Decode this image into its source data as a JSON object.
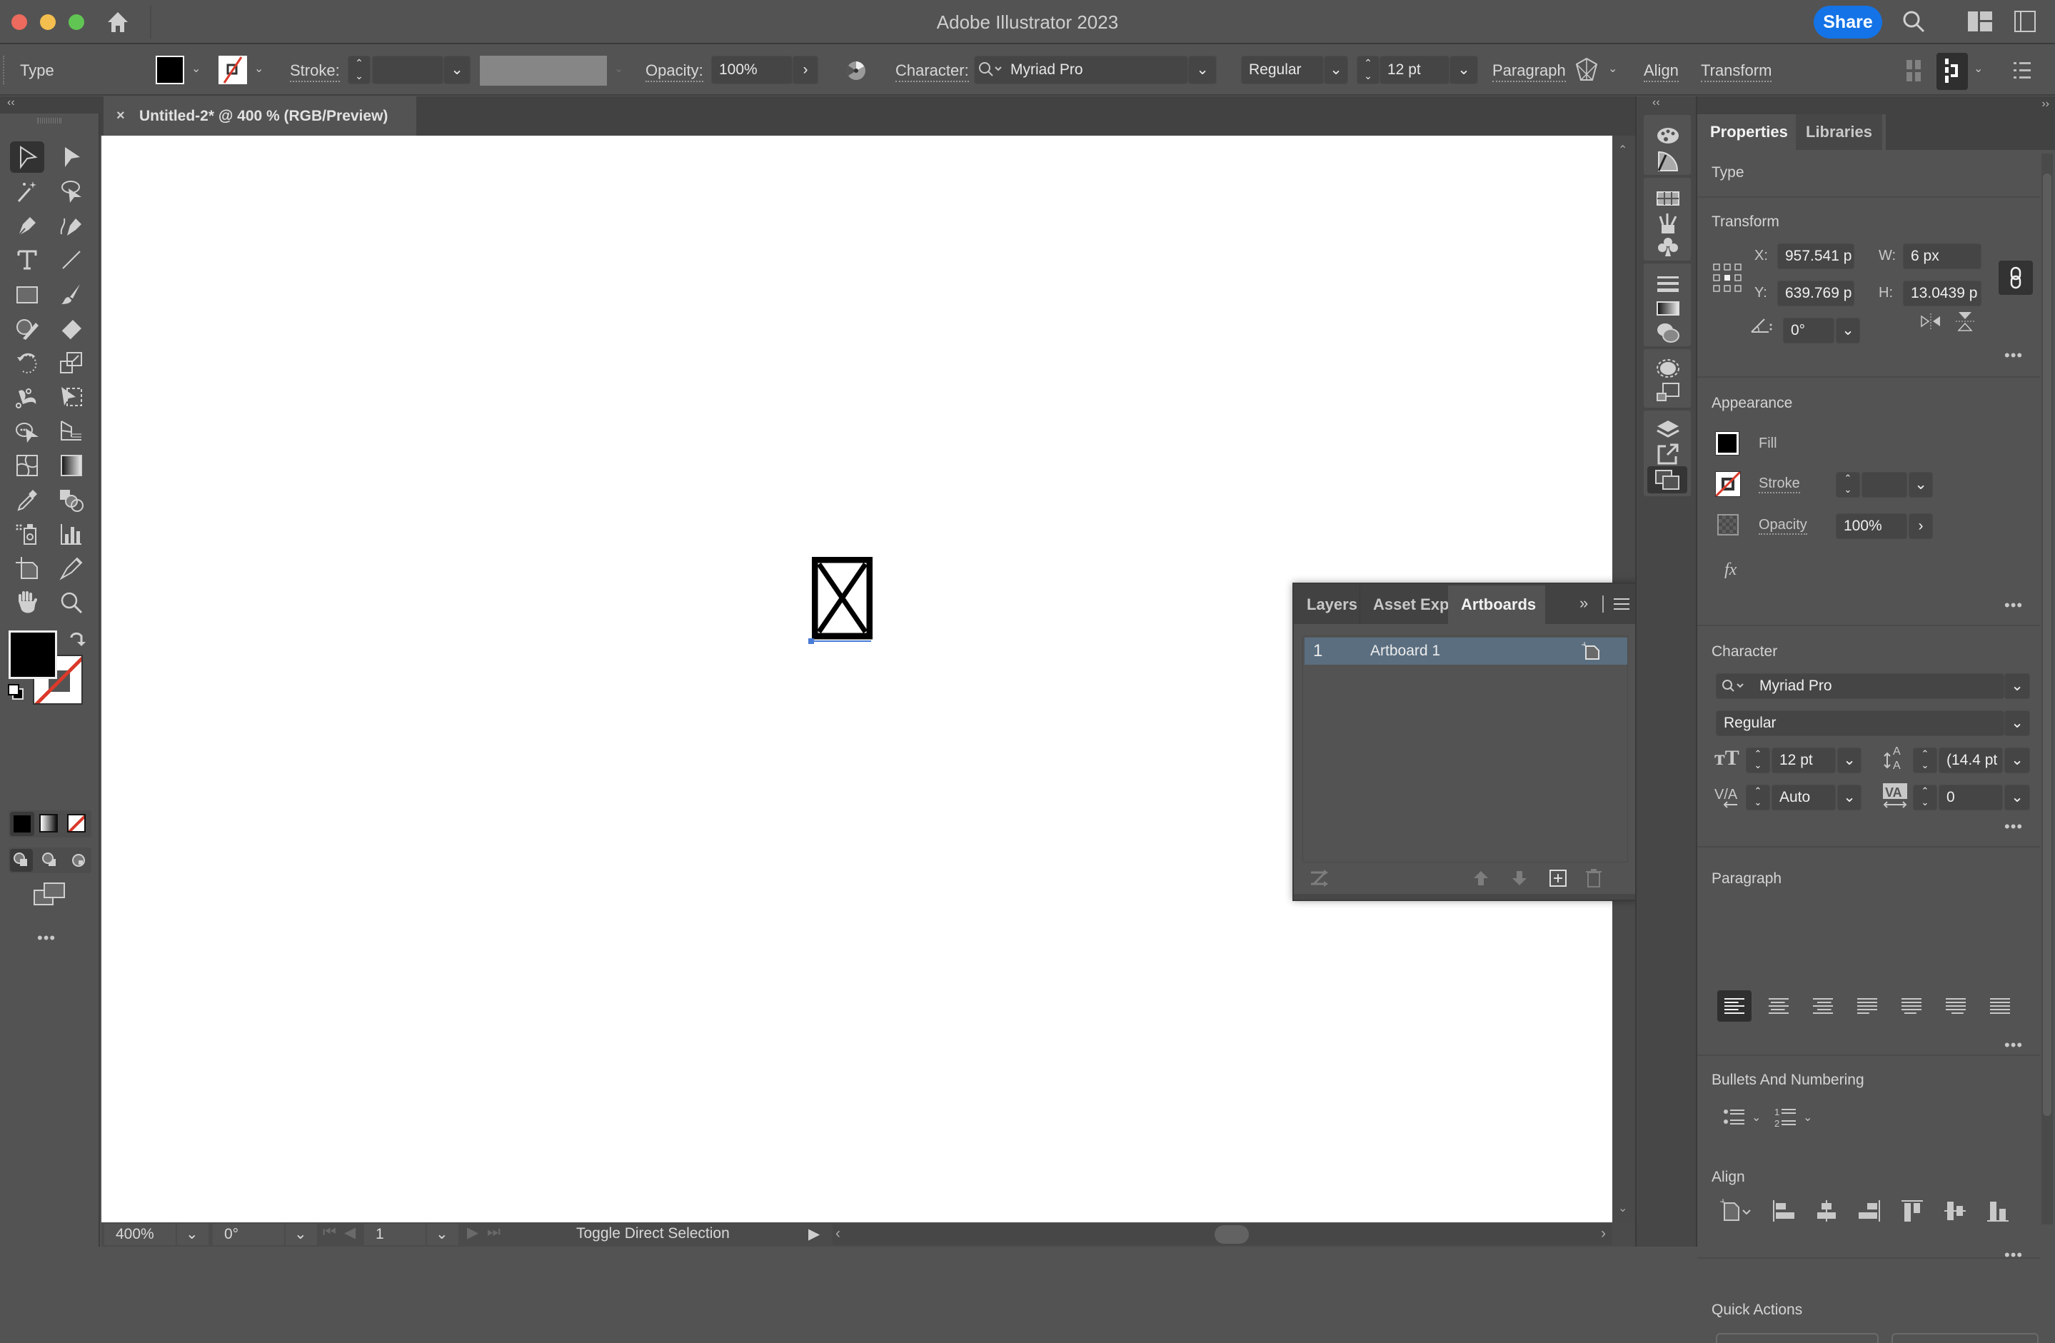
{
  "window": {
    "app_title": "Adobe Illustrator 2023",
    "share_label": "Share",
    "icons": [
      "home-icon",
      "search-icon",
      "workspace-switcher-icon",
      "arrange-documents-icon"
    ]
  },
  "control_bar": {
    "selection_type": "Type",
    "stroke_label": "Stroke:",
    "stroke_value": "",
    "opacity_label": "Opacity:",
    "opacity_value": "100%",
    "character_label": "Character:",
    "font_family": "Myriad Pro",
    "font_style": "Regular",
    "font_size": "12 pt",
    "paragraph_label": "Paragraph",
    "align_label": "Align",
    "transform_label": "Transform",
    "colors": {
      "fill": "#000000",
      "stroke": "none"
    }
  },
  "document_tab": {
    "close_glyph": "×",
    "title": "Untitled-2* @ 400 % (RGB/Preview)"
  },
  "toolbar": {
    "tools": [
      "selection-tool",
      "direct-selection-tool",
      "magic-wand-tool",
      "lasso-tool",
      "pen-tool",
      "curvature-tool",
      "type-tool",
      "line-segment-tool",
      "rectangle-tool",
      "paintbrush-tool",
      "shaper-tool",
      "eraser-tool",
      "rotate-tool",
      "scale-tool",
      "puppet-warp-tool",
      "free-transform-tool",
      "shape-builder-tool",
      "perspective-grid-tool",
      "mesh-tool",
      "gradient-tool",
      "eyedropper-tool",
      "blend-tool",
      "symbol-sprayer-tool",
      "column-graph-tool",
      "artboard-tool",
      "slice-tool",
      "hand-tool",
      "zoom-tool"
    ],
    "selected_tool": "selection-tool",
    "fill_color": "#000000",
    "stroke_color": "none",
    "more_label": "•••"
  },
  "canvas": {
    "glyph": "missing-glyph-box",
    "background": "#ffffff"
  },
  "status_bar": {
    "zoom": "400%",
    "rotation": "0°",
    "artboard_number": "1",
    "status_text": "Toggle Direct Selection"
  },
  "artboards_panel": {
    "tabs": [
      "Layers",
      "Asset Expo",
      "Artboards"
    ],
    "active_tab": "Artboards",
    "rows": [
      {
        "number": "1",
        "name": "Artboard 1"
      }
    ]
  },
  "properties_panel": {
    "tabs": [
      "Properties",
      "Libraries"
    ],
    "active_tab": "Properties",
    "object_type": "Type",
    "transform": {
      "title": "Transform",
      "x_label": "X:",
      "x": "957.541 p",
      "y_label": "Y:",
      "y": "639.769 p",
      "w_label": "W:",
      "w": "6 px",
      "h_label": "H:",
      "h": "13.0439 p",
      "angle": "0°"
    },
    "appearance": {
      "title": "Appearance",
      "fill_label": "Fill",
      "stroke_label": "Stroke",
      "stroke_value": "",
      "opacity_label": "Opacity",
      "opacity_value": "100%",
      "fx_label": "fx"
    },
    "character": {
      "title": "Character",
      "font_family": "Myriad Pro",
      "font_style": "Regular",
      "size": "12 pt",
      "leading": "(14.4 pt",
      "kerning": "Auto",
      "tracking": "0"
    },
    "paragraph": {
      "title": "Paragraph",
      "alignments": [
        "align-left",
        "align-center",
        "align-right",
        "justify-left",
        "justify-center",
        "justify-right",
        "justify-all"
      ],
      "selected": "align-left"
    },
    "bullets": {
      "title": "Bullets And Numbering"
    },
    "align": {
      "title": "Align"
    },
    "quick_actions": {
      "title": "Quick Actions"
    },
    "more_label": "•••"
  }
}
